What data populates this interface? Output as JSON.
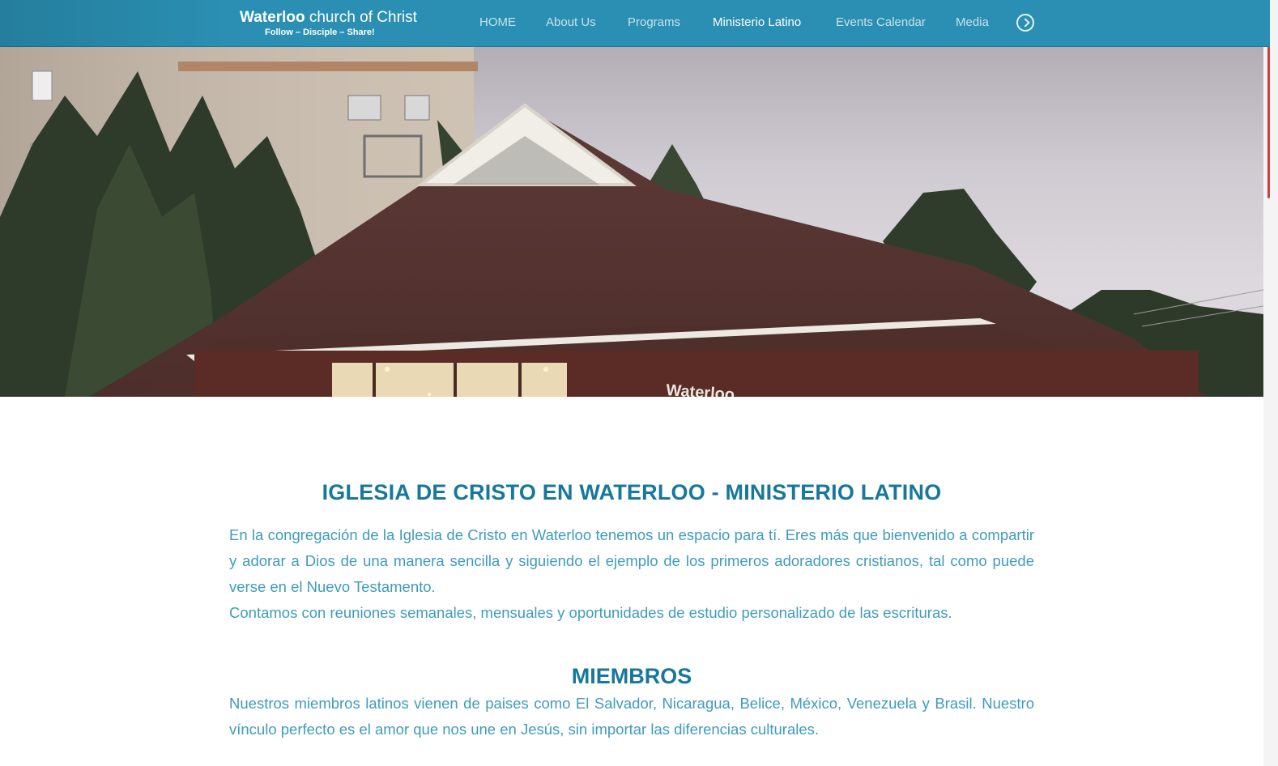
{
  "header": {
    "logo": {
      "word": "Waterloo",
      "rest": " church of Christ",
      "tagline": "Follow – Disciple – Share!"
    },
    "nav": [
      {
        "label": "HOME",
        "active": false
      },
      {
        "label": "About Us",
        "active": false
      },
      {
        "label": "Programs",
        "active": false
      },
      {
        "label": "Ministerio Latino",
        "active": true
      },
      {
        "label": "Events Calendar",
        "active": false
      },
      {
        "label": "Media",
        "active": false
      }
    ],
    "more_icon": "chevron-circle-right-icon"
  },
  "hero": {
    "building_sign": "Waterloo"
  },
  "main": {
    "title": "IGLESIA DE CRISTO EN WATERLOO - MINISTERIO LATINO",
    "intro": "En la congregación de la Iglesia de Cristo en Waterloo tenemos un espacio para tí. Eres más que bienvenido a compartir y adorar a Dios de una manera sencilla y siguiendo el ejemplo de los primeros adoradores cristianos, tal como puede verse en el Nuevo Testamento.",
    "meetings": "Contamos con reuniones semanales, mensuales y oportunidades de estudio personalizado de las escrituras.",
    "members_title": "MIEMBROS",
    "members_text": "Nuestros miembros latinos vienen de paises como El Salvador, Nicaragua, Belice, México, Venezuela y  Brasil. Nuestro vínculo perfecto es el amor que nos une en Jesús, sin importar las diferencias culturales."
  },
  "colors": {
    "header_bg": "#2a8fb2",
    "nav_text": "#c6e3ee",
    "nav_active": "#ffffff",
    "heading": "#17789a",
    "body_text": "#3f9bbd"
  }
}
